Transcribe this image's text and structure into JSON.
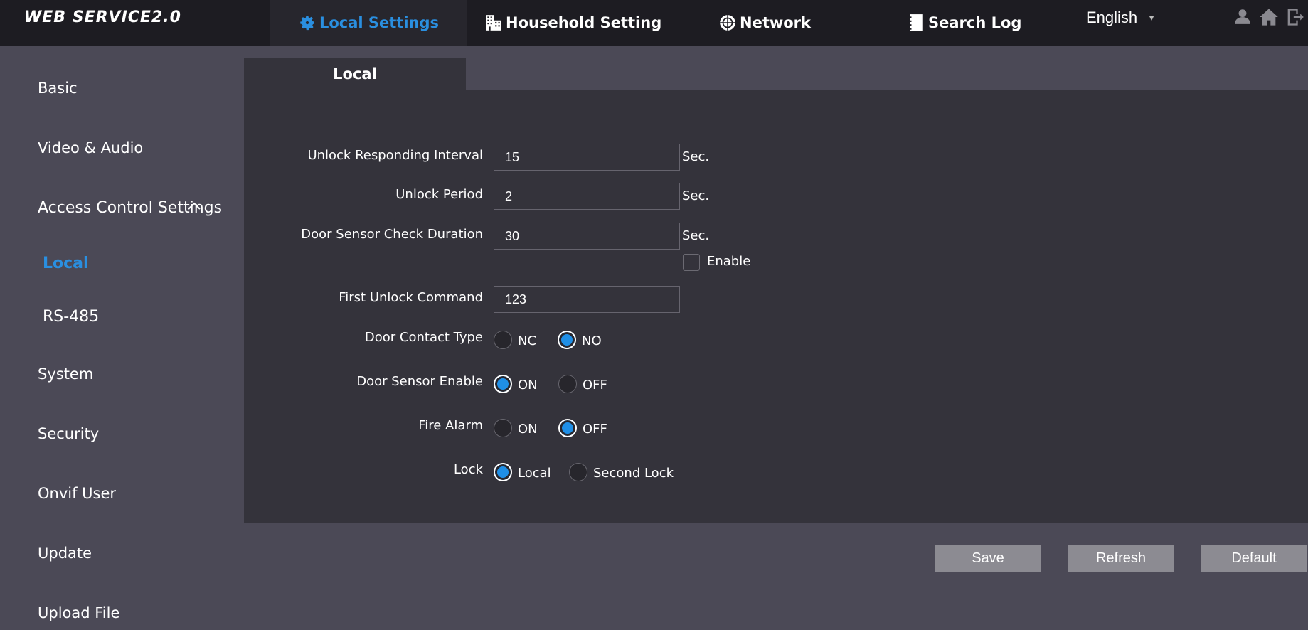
{
  "header": {
    "logo": "WEB SERVICE2.0",
    "nav": [
      {
        "label": "Local Settings",
        "icon": "gear-icon"
      },
      {
        "label": "Household Setting",
        "icon": "building-icon"
      },
      {
        "label": "Network",
        "icon": "network-icon"
      },
      {
        "label": "Search Log",
        "icon": "log-icon"
      }
    ],
    "language": "English",
    "icons": [
      "user-icon",
      "home-icon",
      "logout-icon"
    ]
  },
  "sidebar": {
    "items": [
      {
        "label": "Basic"
      },
      {
        "label": "Video & Audio"
      },
      {
        "label": "Access Control Settings"
      },
      {
        "label": "Local",
        "selected": true
      },
      {
        "label": "RS-485"
      },
      {
        "label": "System"
      },
      {
        "label": "Security"
      },
      {
        "label": "Onvif User"
      },
      {
        "label": "Update"
      },
      {
        "label": "Upload File"
      }
    ]
  },
  "main": {
    "tab": "Local",
    "form": {
      "unlock_interval": {
        "label": "Unlock Responding Interval",
        "value": "15",
        "unit": "Sec."
      },
      "unlock_period": {
        "label": "Unlock Period",
        "value": "2",
        "unit": "Sec."
      },
      "door_sensor_check": {
        "label": "Door Sensor Check Duration",
        "value": "30",
        "unit": "Sec."
      },
      "enable": {
        "label": "Enable",
        "checked": false
      },
      "first_unlock": {
        "label": "First Unlock Command",
        "value": "123"
      },
      "door_contact_type": {
        "label": "Door Contact Type",
        "options": [
          "NC",
          "NO"
        ],
        "selected": "NO"
      },
      "door_sensor_enable": {
        "label": "Door Sensor Enable",
        "options": [
          "ON",
          "OFF"
        ],
        "selected": "ON"
      },
      "fire_alarm": {
        "label": "Fire Alarm",
        "options": [
          "ON",
          "OFF"
        ],
        "selected": "OFF"
      },
      "lock": {
        "label": "Lock",
        "options": [
          "Local",
          "Second Lock"
        ],
        "selected": "Local"
      }
    }
  },
  "buttons": {
    "save": "Save",
    "refresh": "Refresh",
    "default": "Default"
  },
  "colors": {
    "accent": "#2a8fe0",
    "topbar": "#1d1c22",
    "sidebar": "#4b4956",
    "panel": "#34333b",
    "button": "#8c8b92"
  }
}
